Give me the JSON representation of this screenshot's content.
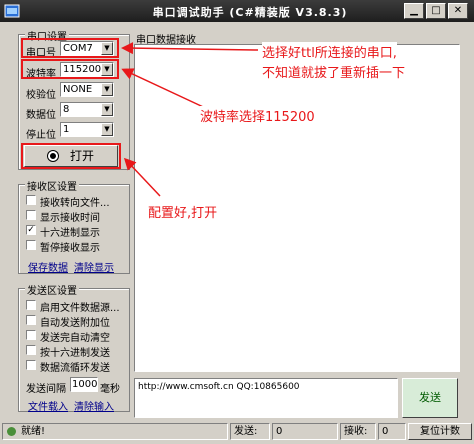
{
  "window": {
    "title": "串口调试助手 (C#精装版 V3.8.3)",
    "icon": "app-icon"
  },
  "serial_settings": {
    "title": "串口设置",
    "port_label": "串口号",
    "port_value": "COM7",
    "baud_label": "波特率",
    "baud_value": "115200",
    "parity_label": "校验位",
    "parity_value": "NONE",
    "databits_label": "数据位",
    "databits_value": "8",
    "stopbits_label": "停止位",
    "stopbits_value": "1",
    "open_button_label": "打开"
  },
  "receive_settings": {
    "title": "接收区设置",
    "options": [
      {
        "label": "接收转向文件...",
        "checked": false
      },
      {
        "label": "显示接收时间",
        "checked": false
      },
      {
        "label": "十六进制显示",
        "checked": true
      },
      {
        "label": "暂停接收显示",
        "checked": false
      }
    ],
    "save_link": "保存数据",
    "clear_link": "清除显示"
  },
  "send_settings": {
    "title": "发送区设置",
    "options": [
      {
        "label": "启用文件数据源...",
        "checked": false
      },
      {
        "label": "自动发送附加位",
        "checked": false
      },
      {
        "label": "发送完自动清空",
        "checked": false
      },
      {
        "label": "按十六进制发送",
        "checked": false
      },
      {
        "label": "数据流循环发送",
        "checked": false
      }
    ],
    "interval_label": "发送间隔",
    "interval_value": "1000",
    "interval_unit": "毫秒",
    "load_link": "文件载入",
    "clear_input_link": "清除输入"
  },
  "receive_area": {
    "title": "串口数据接收",
    "content": ""
  },
  "send_area": {
    "content": "http://www.cmsoft.cn QQ:10865600",
    "send_button": "发送"
  },
  "statusbar": {
    "status_text": "就绪!",
    "send_label": "发送:",
    "send_count": "0",
    "recv_label": "接收:",
    "recv_count": "0",
    "reset_button": "复位计数"
  },
  "annotations": {
    "port_note_line1": "选择好ttl所连接的串口,",
    "port_note_line2": "不知道就拔了重新插一下",
    "baud_note": "波特率选择115200",
    "open_note": "配置好,打开"
  },
  "colors": {
    "annotation": "#e8181a",
    "link": "#00008b",
    "send_button_bg": "#d8ecd8"
  }
}
